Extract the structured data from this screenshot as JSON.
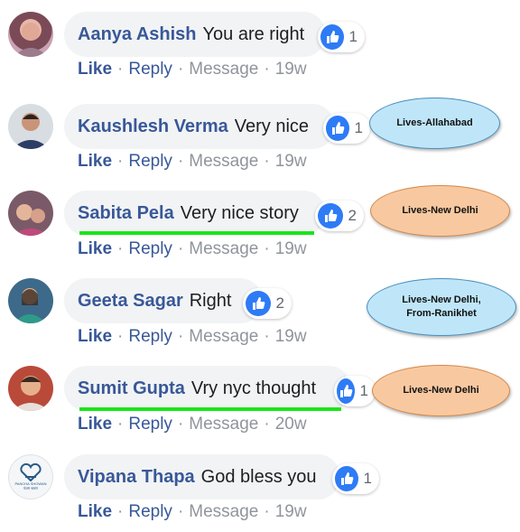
{
  "comments": [
    {
      "name": "Aanya Ashish",
      "text": "You are right",
      "reactions": "1",
      "like": "Like",
      "reply": "Reply",
      "message": "Message",
      "time": "19w"
    },
    {
      "name": "Kaushlesh Verma",
      "text": "Very nice",
      "reactions": "1",
      "like": "Like",
      "reply": "Reply",
      "message": "Message",
      "time": "19w"
    },
    {
      "name": "Sabita Pela",
      "text": "Very nice story",
      "reactions": "2",
      "like": "Like",
      "reply": "Reply",
      "message": "Message",
      "time": "19w"
    },
    {
      "name": "Geeta Sagar",
      "text": "Right",
      "reactions": "2",
      "like": "Like",
      "reply": "Reply",
      "message": "Message",
      "time": "19w"
    },
    {
      "name": "Sumit Gupta",
      "text": "Vry nyc thought",
      "reactions": "1",
      "like": "Like",
      "reply": "Reply",
      "message": "Message",
      "time": "20w"
    },
    {
      "name": "Vipana Thapa",
      "text": "God bless you",
      "reactions": "1",
      "like": "Like",
      "reply": "Reply",
      "message": "Message",
      "time": "19w"
    }
  ],
  "annotations": [
    {
      "text": "Lives-Allahabad",
      "color": "blue"
    },
    {
      "text": "Lives-New Delhi",
      "color": "orange"
    },
    {
      "line1": "Lives-New Delhi,",
      "line2": "From-Ranikhet",
      "color": "blue"
    },
    {
      "text": "Lives-New Delhi",
      "color": "orange"
    }
  ],
  "logo_text": {
    "line1": "PANCHA SHOWAN",
    "line2": "पंचम श्रवण"
  },
  "colors": {
    "accent": "#385898",
    "like_blue": "#2e7bf6",
    "highlight": "#19e619",
    "bubble": "#f2f3f5"
  }
}
